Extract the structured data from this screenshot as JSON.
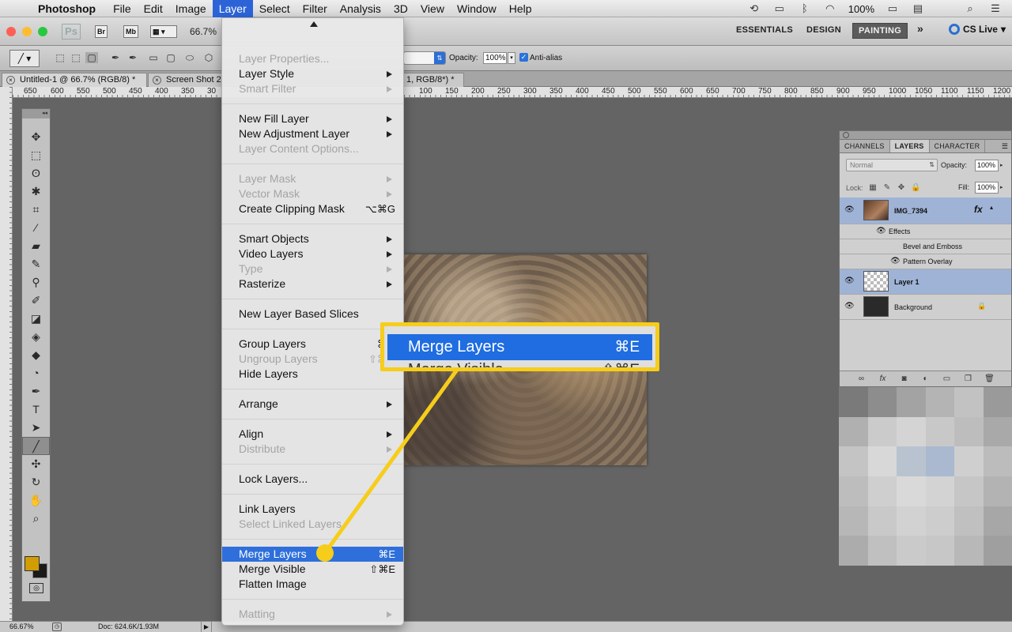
{
  "menubar": {
    "app_name": "Photoshop",
    "menus": [
      "File",
      "Edit",
      "Image",
      "Layer",
      "Select",
      "Filter",
      "Analysis",
      "3D",
      "View",
      "Window",
      "Help"
    ],
    "active_menu": "Layer",
    "battery": "100%"
  },
  "appbar": {
    "ps": "Ps",
    "br": "Br",
    "mb": "Mb",
    "zoom": "66.7%",
    "workspaces": [
      "ESSENTIALS",
      "DESIGN",
      "PAINTING"
    ],
    "active_workspace": "PAINTING",
    "more": "»",
    "cs_live": "CS Live"
  },
  "options": {
    "opacity_label": "Opacity:",
    "opacity_value": "100%",
    "antialias_label": "Anti-alias"
  },
  "tabs": [
    {
      "label": "Untitled-1 @ 66.7% (RGB/8) *"
    },
    {
      "label": "Screen Shot 2"
    },
    {
      "label": "1, RGB/8*) *"
    }
  ],
  "ruler": {
    "left_labels": [
      "650",
      "600",
      "550",
      "500",
      "450",
      "400",
      "350",
      "30"
    ],
    "right_labels": [
      "100",
      "150",
      "200",
      "250",
      "300",
      "350",
      "400",
      "450",
      "500",
      "550",
      "600",
      "650",
      "700",
      "750",
      "800",
      "850",
      "900",
      "950",
      "1000",
      "1050",
      "1100",
      "1150",
      "1200"
    ]
  },
  "tools": [
    "move",
    "marquee",
    "lasso",
    "quick-select",
    "crop",
    "eyedropper",
    "healing",
    "brush",
    "stamp",
    "history-brush",
    "eraser",
    "bucket",
    "blur",
    "dodge",
    "pen",
    "type",
    "path-select",
    "line",
    "3d-rotate",
    "3d-orbit",
    "hand",
    "zoom"
  ],
  "colors": {
    "foreground": "#d29c05",
    "background": "#1a1a1a",
    "menu_highlight": "#2e6fdb",
    "callout_border": "#f6cd1a"
  },
  "layer_menu": {
    "items": [
      {
        "label": "Layer Properties...",
        "disabled": true
      },
      {
        "label": "Layer Style",
        "submenu": true
      },
      {
        "label": "Smart Filter",
        "disabled": true,
        "submenu": true
      },
      {
        "label": "New Fill Layer",
        "submenu": true
      },
      {
        "label": "New Adjustment Layer",
        "submenu": true
      },
      {
        "label": "Layer Content Options...",
        "disabled": true
      },
      {
        "label": "Layer Mask",
        "disabled": true,
        "submenu": true
      },
      {
        "label": "Vector Mask",
        "disabled": true,
        "submenu": true
      },
      {
        "label": "Create Clipping Mask",
        "shortcut": "⌥⌘G"
      },
      {
        "label": "Smart Objects",
        "submenu": true
      },
      {
        "label": "Video Layers",
        "submenu": true
      },
      {
        "label": "Type",
        "disabled": true,
        "submenu": true
      },
      {
        "label": "Rasterize",
        "submenu": true
      },
      {
        "label": "New Layer Based Slices"
      },
      {
        "label": "Group Layers",
        "shortcut": "⌘G"
      },
      {
        "label": "Ungroup Layers",
        "disabled": true,
        "shortcut": "⇧⌘G"
      },
      {
        "label": "Hide Layers"
      },
      {
        "label": "Arrange",
        "submenu": true
      },
      {
        "label": "Align",
        "submenu": true
      },
      {
        "label": "Distribute",
        "disabled": true,
        "submenu": true
      },
      {
        "label": "Lock Layers..."
      },
      {
        "label": "Link Layers"
      },
      {
        "label": "Select Linked Layers",
        "disabled": true
      },
      {
        "label": "Merge Layers",
        "shortcut": "⌘E",
        "highlighted": true
      },
      {
        "label": "Merge Visible",
        "shortcut": "⇧⌘E"
      },
      {
        "label": "Flatten Image"
      },
      {
        "label": "Matting",
        "disabled": true,
        "submenu": true
      }
    ]
  },
  "callout": {
    "label": "Merge Layers",
    "shortcut": "⌘E",
    "peek_label": "Merge Visible",
    "peek_shortcut": "⇧⌘E"
  },
  "layers_panel": {
    "tabs": [
      "CHANNELS",
      "LAYERS",
      "CHARACTER"
    ],
    "active_tab": "LAYERS",
    "blend_mode": "Normal",
    "opacity_label": "Opacity:",
    "opacity_value": "100%",
    "lock_label": "Lock:",
    "fill_label": "Fill:",
    "fill_value": "100%",
    "layers": [
      {
        "name": "IMG_7394",
        "fx": "fx"
      },
      {
        "name": "Layer 1"
      },
      {
        "name": "Background"
      }
    ],
    "effects_label": "Effects",
    "effects": [
      "Bevel and Emboss",
      "Pattern Overlay"
    ]
  },
  "status": {
    "zoom": "66.67%",
    "doc": "Doc: 624.6K/1.93M"
  }
}
